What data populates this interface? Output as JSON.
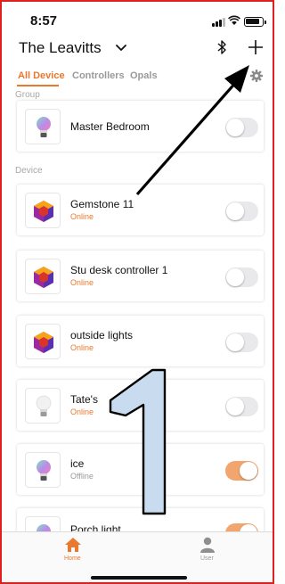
{
  "status_bar": {
    "time": "8:57"
  },
  "header": {
    "home_name": "The Leavitts"
  },
  "tabs": [
    {
      "label": "All Device",
      "active": true
    },
    {
      "label": "Controllers",
      "active": false
    },
    {
      "label": "Opals",
      "active": false
    }
  ],
  "sections": {
    "group": "Group",
    "device": "Device"
  },
  "group_items": [
    {
      "name": "Master Bedroom",
      "icon": "rgb-bulb-icon",
      "on": false
    }
  ],
  "device_items": [
    {
      "name": "Gemstone 11",
      "status": "Online",
      "icon": "gemstone-controller-icon",
      "on": false
    },
    {
      "name": "Stu desk controller 1",
      "status": "Online",
      "icon": "gemstone-controller-icon",
      "on": false
    },
    {
      "name": "outside lights",
      "status": "Online",
      "icon": "gemstone-controller-icon",
      "on": false
    },
    {
      "name": "Tate's",
      "status": "Online",
      "icon": "white-bulb-icon",
      "on": false
    },
    {
      "name": "ice",
      "status": "Offline",
      "icon": "rgb-bulb-icon",
      "on": true
    },
    {
      "name": "Porch light",
      "icon": "rgb-bulb-icon",
      "on": true
    }
  ],
  "bottom_nav": [
    {
      "label": "Home",
      "icon": "home-icon",
      "active": true
    },
    {
      "label": "User",
      "icon": "user-icon",
      "active": false
    }
  ],
  "annotation": {
    "label": "1",
    "arrow": "arrow pointing to add-device button"
  },
  "colors": {
    "accent": "#e8792e",
    "toggle_on": "#f2a56d",
    "toggle_off": "#e9e9ec",
    "annotation_fill": "#c9dcef",
    "frame": "#e0201e"
  }
}
